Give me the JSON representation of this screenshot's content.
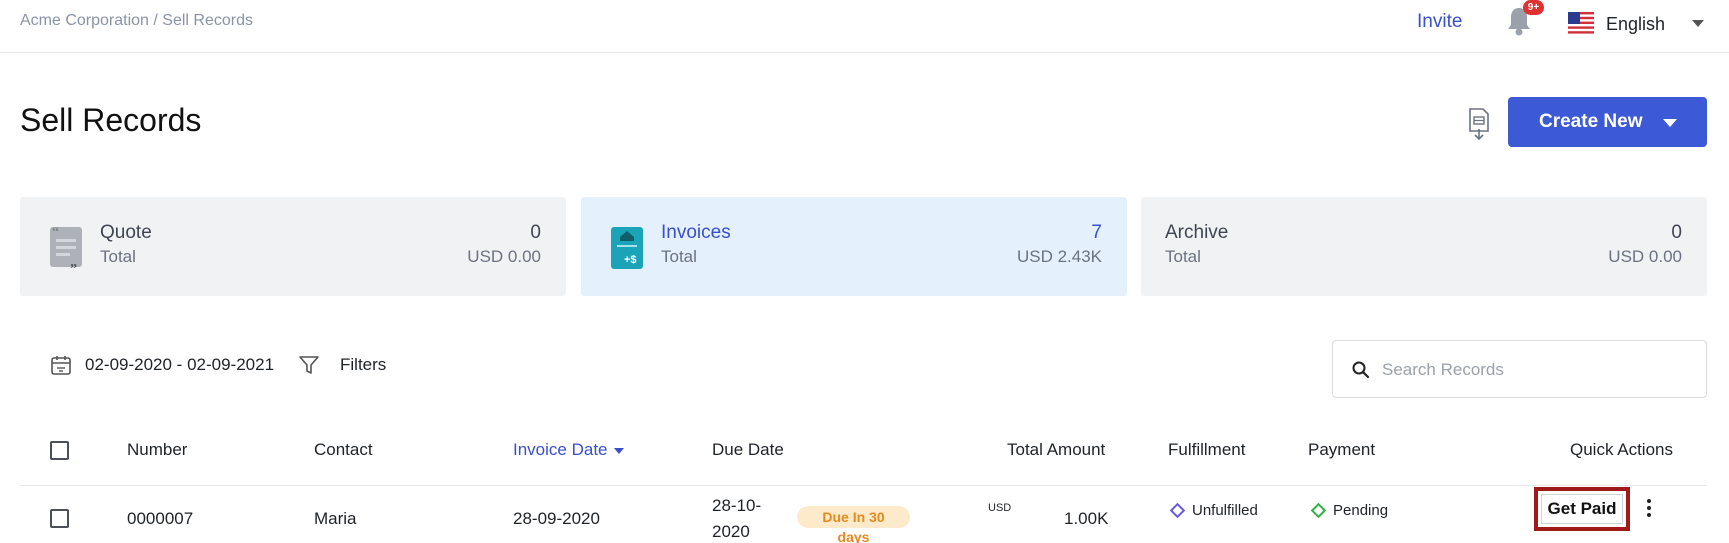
{
  "header": {
    "breadcrumb": "Acme Corporation / Sell Records",
    "invite_label": "Invite",
    "notification_badge": "9+",
    "language": "English"
  },
  "page": {
    "title": "Sell Records",
    "create_label": "Create New"
  },
  "cards": [
    {
      "title": "Quote",
      "sub": "Total",
      "count": "0",
      "amount": "USD 0.00",
      "icon": "quote-document-icon"
    },
    {
      "title": "Invoices",
      "sub": "Total",
      "count": "7",
      "amount": "USD 2.43K",
      "icon": "invoice-icon"
    },
    {
      "title": "Archive",
      "sub": "Total",
      "count": "0",
      "amount": "USD 0.00"
    }
  ],
  "toolbar": {
    "date_range": "02-09-2020 - 02-09-2021",
    "filters_label": "Filters",
    "search_placeholder": "Search Records"
  },
  "table": {
    "columns": [
      "Number",
      "Contact",
      "Invoice Date",
      "Due Date",
      "Total Amount",
      "Fulfillment",
      "Payment",
      "Quick Actions"
    ],
    "sorted_column": "Invoice Date",
    "rows": [
      {
        "number": "0000007",
        "contact": "Maria",
        "invoice_date": "28-09-2020",
        "due_date_line1": "28-10-",
        "due_date_line2": "2020",
        "due_badge_line1": "Due In 30",
        "due_badge_line2": "days",
        "currency": "USD",
        "amount": "1.00K",
        "fulfillment": "Unfulfilled",
        "payment": "Pending",
        "action_label": "Get Paid"
      }
    ]
  },
  "colors": {
    "accent": "#3d5ad6",
    "link": "#3a4fcf",
    "fulfillment_diamond": "#6b5be0",
    "payment_diamond": "#2fb344",
    "due_badge_bg": "#fdeacb",
    "due_badge_text": "#e7891e",
    "highlight_border": "#a11a1a"
  }
}
